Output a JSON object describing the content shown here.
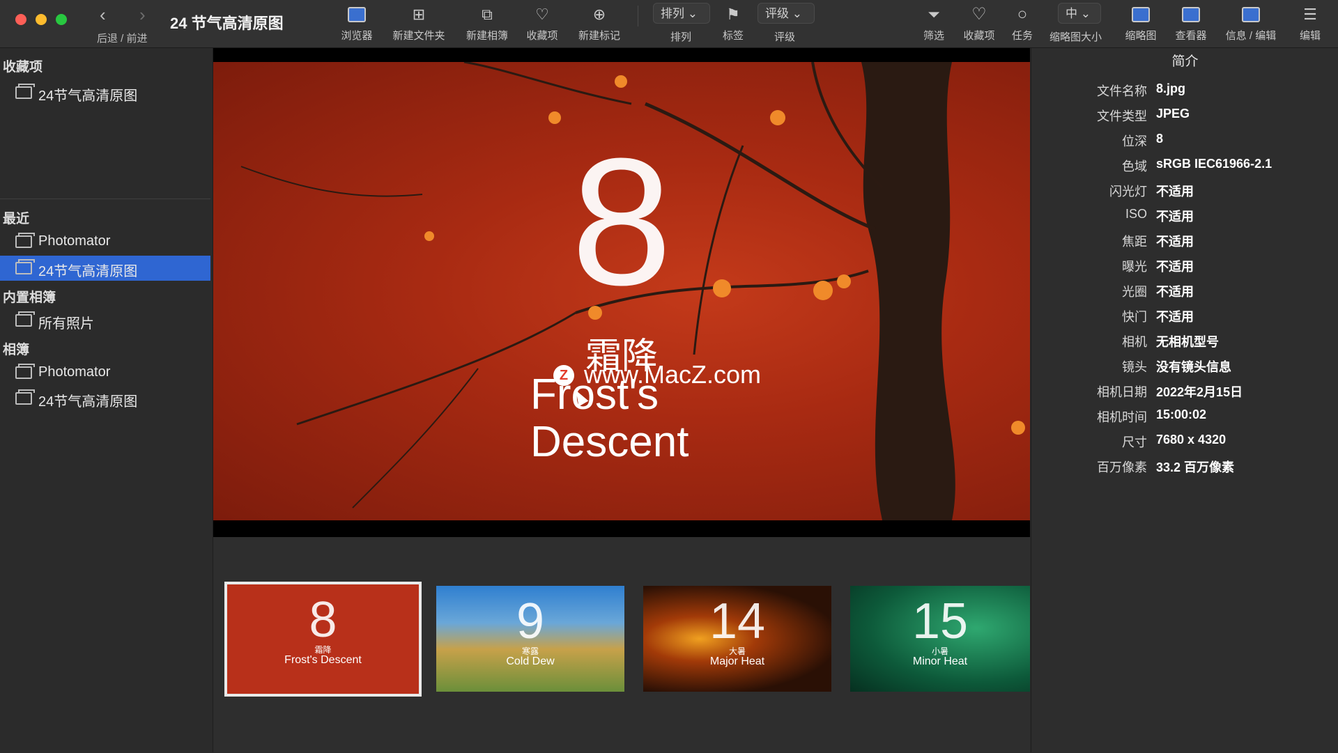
{
  "toolbar": {
    "title": "24 节气高清原图",
    "nav_label": "后退 / 前进",
    "buttons": {
      "browser": "浏览器",
      "new_folder": "新建文件夹",
      "new_album": "新建相簿",
      "favorites": "收藏项",
      "new_marker": "新建标记",
      "sort_value": "排列",
      "sort_label": "排列",
      "tag": "标签",
      "rating_value": "评级",
      "rating_label": "评级",
      "filter": "筛选",
      "favorites_right": "收藏项",
      "tasks": "任务",
      "thumb_size_value": "中",
      "thumb_size_label": "缩略图大小",
      "thumbnails": "缩略图",
      "viewer": "查看器",
      "info_edit": "信息 / 编辑",
      "edit": "编辑"
    }
  },
  "sidebar": {
    "favorites_header": "收藏项",
    "favorites": [
      "24节气高清原图"
    ],
    "recent_header": "最近",
    "recent": [
      "Photomator",
      "24节气高清原图"
    ],
    "builtin_header": "内置相簿",
    "builtin": [
      "所有照片"
    ],
    "albums_header": "相簿",
    "albums": [
      "Photomator",
      "24节气高清原图"
    ]
  },
  "preview": {
    "number": "8",
    "cn_title": "霜降",
    "en_line1": "Frost's",
    "en_line2": "Descent",
    "watermark": "www.MacZ.com",
    "watermark_badge": "Z"
  },
  "filmstrip": [
    {
      "number": "8",
      "cn": "霜降",
      "en": "Frost's Descent",
      "bg": "#b8301a"
    },
    {
      "number": "9",
      "cn": "寒露",
      "en": "Cold Dew",
      "bg": "#5f8d3a"
    },
    {
      "number": "14",
      "cn": "大暑",
      "en": "Major Heat",
      "bg": "#3a1a08"
    },
    {
      "number": "15",
      "cn": "小暑",
      "en": "Minor Heat",
      "bg": "#0f5f3e"
    }
  ],
  "info": {
    "title": "简介",
    "rows": [
      {
        "key": "文件名称",
        "value": "8.jpg"
      },
      {
        "key": "文件类型",
        "value": "JPEG"
      },
      {
        "key": "位深",
        "value": "8"
      },
      {
        "key": "色域",
        "value": "sRGB IEC61966-2.1"
      },
      {
        "key": "闪光灯",
        "value": "不适用"
      },
      {
        "key": "ISO",
        "value": "不适用"
      },
      {
        "key": "焦距",
        "value": "不适用"
      },
      {
        "key": "曝光",
        "value": "不适用"
      },
      {
        "key": "光圈",
        "value": "不适用"
      },
      {
        "key": "快门",
        "value": "不适用"
      },
      {
        "key": "相机",
        "value": "无相机型号"
      },
      {
        "key": "镜头",
        "value": "没有镜头信息"
      },
      {
        "key": "相机日期",
        "value": "2022年2月15日"
      },
      {
        "key": "相机时间",
        "value": "15:00:02"
      },
      {
        "key": "尺寸",
        "value": "7680 x 4320"
      },
      {
        "key": "百万像素",
        "value": "33.2 百万像素"
      }
    ]
  }
}
